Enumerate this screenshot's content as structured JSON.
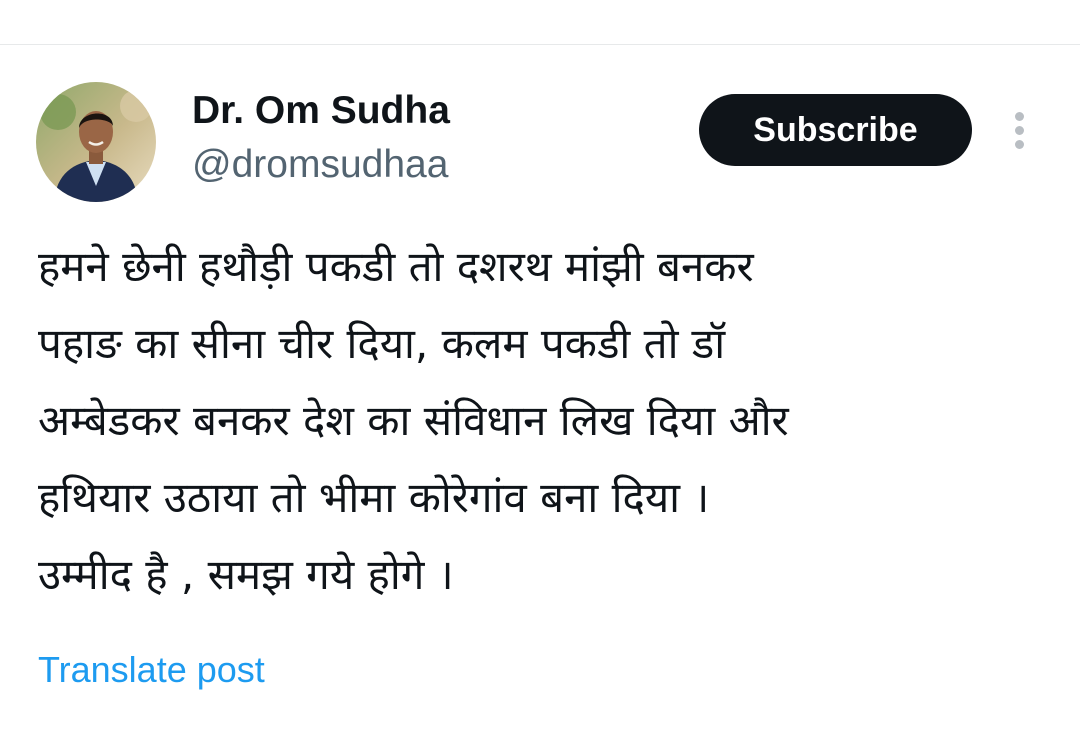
{
  "author": {
    "name": "Dr. Om Sudha",
    "handle": "@dromsudhaa"
  },
  "subscribe_label": "Subscribe",
  "more_icon": "more-vertical-icon",
  "tweet": {
    "lines": [
      "हमने छेनी हथौड़ी पकडी तो दशरथ मांझी बनकर",
      "पहाङ का सीना चीर दिया, कलम पकडी तो डॉ",
      "अम्बेडकर बनकर देश का  संविधान लिख दिया और",
      "हथियार उठाया तो भीमा कोरेगांव बना दिया ।",
      "उम्मीद है , समझ गये होगे ।"
    ]
  },
  "translate_label": "Translate post",
  "colors": {
    "text": "#0f1419",
    "secondary": "#536471",
    "link": "#1d9bf0",
    "button_bg": "#0f1419"
  }
}
